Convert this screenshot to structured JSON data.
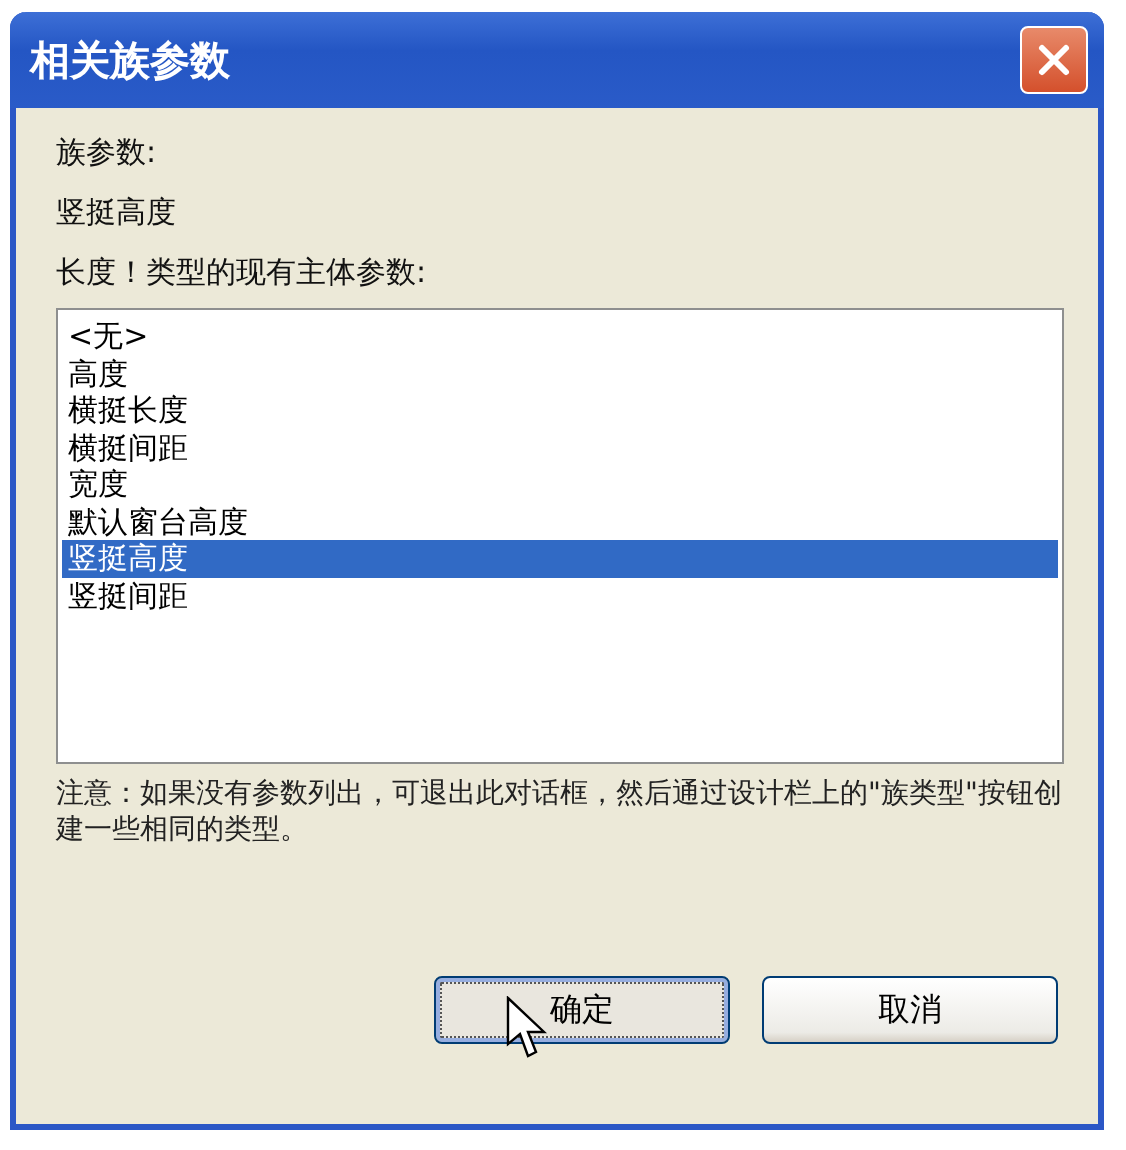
{
  "window": {
    "title": "相关族参数"
  },
  "family_parameter_label": "族参数:",
  "family_parameter_value": "竖挺高度",
  "list_label": "长度！类型的现有主体参数:",
  "parameters": [
    {
      "label": "<无>",
      "selected": false
    },
    {
      "label": "高度",
      "selected": false
    },
    {
      "label": "横挺长度",
      "selected": false
    },
    {
      "label": "横挺间距",
      "selected": false
    },
    {
      "label": "宽度",
      "selected": false
    },
    {
      "label": "默认窗台高度",
      "selected": false
    },
    {
      "label": "竖挺高度",
      "selected": true
    },
    {
      "label": "竖挺间距",
      "selected": false
    }
  ],
  "note": "注意：如果没有参数列出，可退出此对话框，然后通过设计栏上的\"族类型\"按钮创建一些相同的类型。",
  "buttons": [
    {
      "label": "确定",
      "focused": true
    },
    {
      "label": "取消",
      "focused": false
    }
  ]
}
